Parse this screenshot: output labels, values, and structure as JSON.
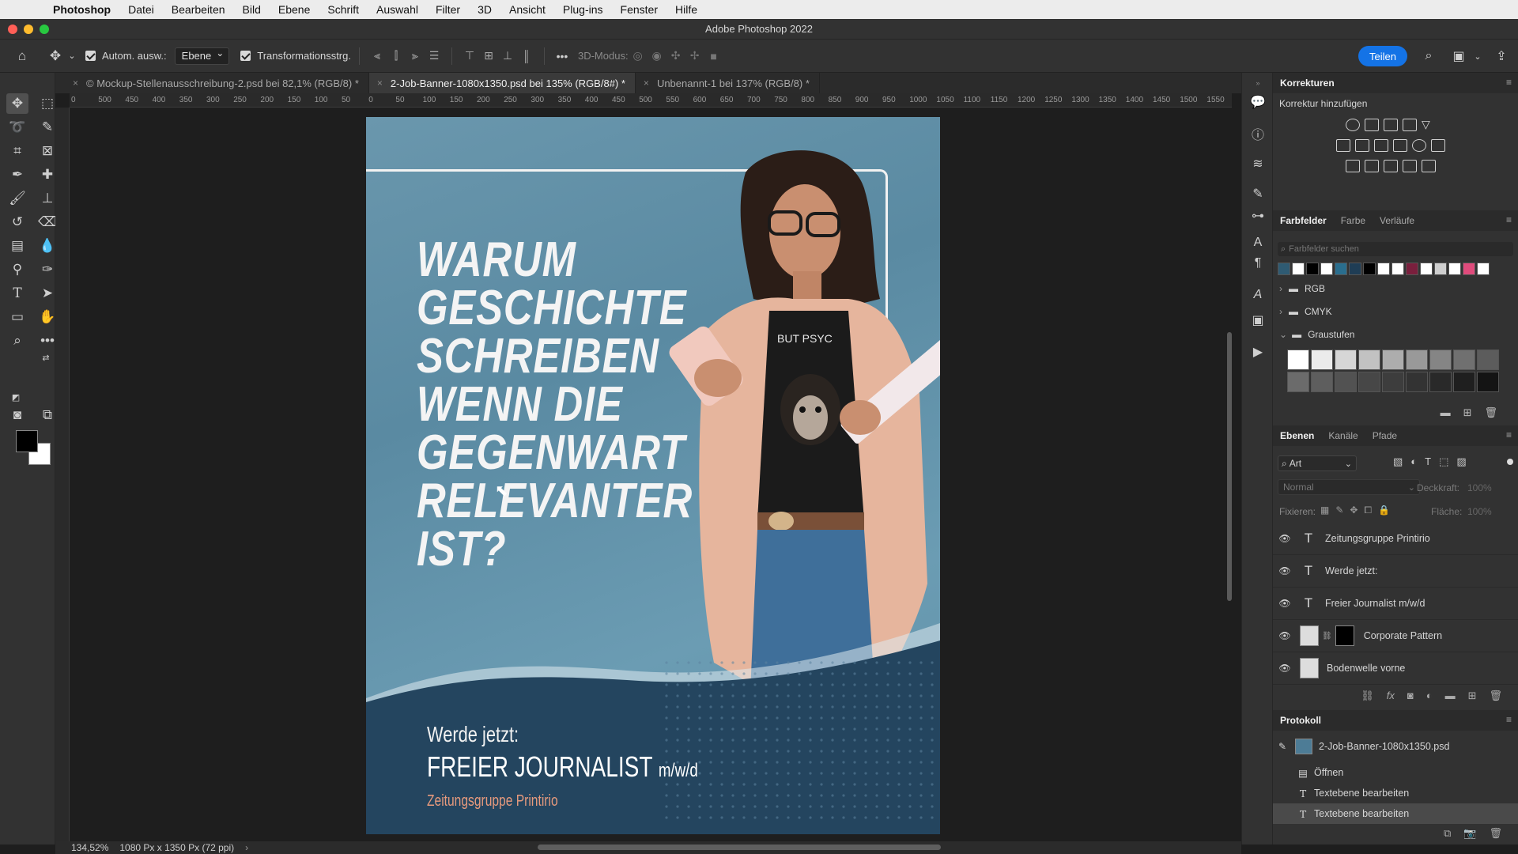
{
  "menubar": {
    "app": "Photoshop",
    "items": [
      "Datei",
      "Bearbeiten",
      "Bild",
      "Ebene",
      "Schrift",
      "Auswahl",
      "Filter",
      "3D",
      "Ansicht",
      "Plug-ins",
      "Fenster",
      "Hilfe"
    ]
  },
  "window": {
    "title": "Adobe Photoshop 2022"
  },
  "options": {
    "auto_select_label": "Autom. ausw.:",
    "auto_select_value": "Ebene",
    "transform_label": "Transformationsstrg.",
    "mode3d_label": "3D-Modus:",
    "share_label": "Teilen"
  },
  "tabs": [
    {
      "label": "© Mockup-Stellenausschreibung-2.psd bei 82,1% (RGB/8) *"
    },
    {
      "label": "2-Job-Banner-1080x1350.psd bei 135% (RGB/8#) *"
    },
    {
      "label": "Unbenannt-1 bei 137% (RGB/8) *"
    }
  ],
  "ruler": [
    "0",
    "500",
    "450",
    "400",
    "350",
    "300",
    "250",
    "200",
    "150",
    "100",
    "50",
    "0",
    "50",
    "100",
    "150",
    "200",
    "250",
    "300",
    "350",
    "400",
    "450",
    "500",
    "550",
    "600",
    "650",
    "700",
    "750",
    "800",
    "850",
    "900",
    "950",
    "1000",
    "1050",
    "1100",
    "1150",
    "1200",
    "1250",
    "1300",
    "1350",
    "1400",
    "1450",
    "1500",
    "1550"
  ],
  "artwork": {
    "headline": [
      "WARUM",
      "GESCHICHTE",
      "SCHREIBEN",
      "WENN DIE",
      "GEGENWART",
      "RELEVANTER",
      "IST?"
    ],
    "cta_line1": "Werde jetzt:",
    "cta_line2": "FREIER JOURNALIST",
    "cta_line2_suffix": "m/w/d",
    "cta_line3": "Zeitungsgruppe Printirio",
    "shirt_text": "BUT PSYC"
  },
  "panels": {
    "corrections": {
      "title": "Korrekturen",
      "subtitle": "Korrektur hinzufügen"
    },
    "swatches": {
      "tabs": [
        "Farbfelder",
        "Farbe",
        "Verläufe"
      ],
      "search_placeholder": "Farbfelder suchen",
      "top_swatches": [
        "#2f5b73",
        "#ffffff",
        "#000000",
        "#ffffff",
        "#2a6e8e",
        "#1f3d55",
        "#000000",
        "#ffffff",
        "#ffffff",
        "#7a1f3d",
        "#ffffff",
        "#cfcfcf",
        "#ffffff",
        "#e04b7c",
        "#ffffff"
      ],
      "groups": [
        "RGB",
        "CMYK",
        "Graustufen"
      ],
      "gray_row1": [
        "#ffffff",
        "#ebebeb",
        "#d6d6d6",
        "#c2c2c2",
        "#adadad",
        "#999999",
        "#858585",
        "#707070",
        "#5c5c5c"
      ],
      "gray_row2": [
        "#6b6b6b",
        "#5e5e5e",
        "#525252",
        "#474747",
        "#3d3d3d",
        "#333333",
        "#292929",
        "#1f1f1f",
        "#141414"
      ]
    },
    "layers": {
      "tabs": [
        "Ebenen",
        "Kanäle",
        "Pfade"
      ],
      "filter_label": "Art",
      "blend_mode": "Normal",
      "opacity_label": "Deckkraft:",
      "opacity_value": "100%",
      "lock_label": "Fixieren:",
      "fill_label": "Fläche:",
      "fill_value": "100%",
      "items": [
        {
          "name": "Zeitungsgruppe Printirio",
          "kind": "text"
        },
        {
          "name": "Werde jetzt:",
          "kind": "text"
        },
        {
          "name": "Freier Journalist m/w/d",
          "kind": "text"
        },
        {
          "name": "Corporate Pattern",
          "kind": "masked"
        },
        {
          "name": "Bodenwelle vorne",
          "kind": "image"
        }
      ]
    },
    "history": {
      "title": "Protokoll",
      "snapshot": "2-Job-Banner-1080x1350.psd",
      "items": [
        "Öffnen",
        "Textebene bearbeiten",
        "Textebene bearbeiten"
      ]
    }
  },
  "status": {
    "zoom": "134,52%",
    "doc_info": "1080 Px x 1350 Px (72 ppi)"
  }
}
